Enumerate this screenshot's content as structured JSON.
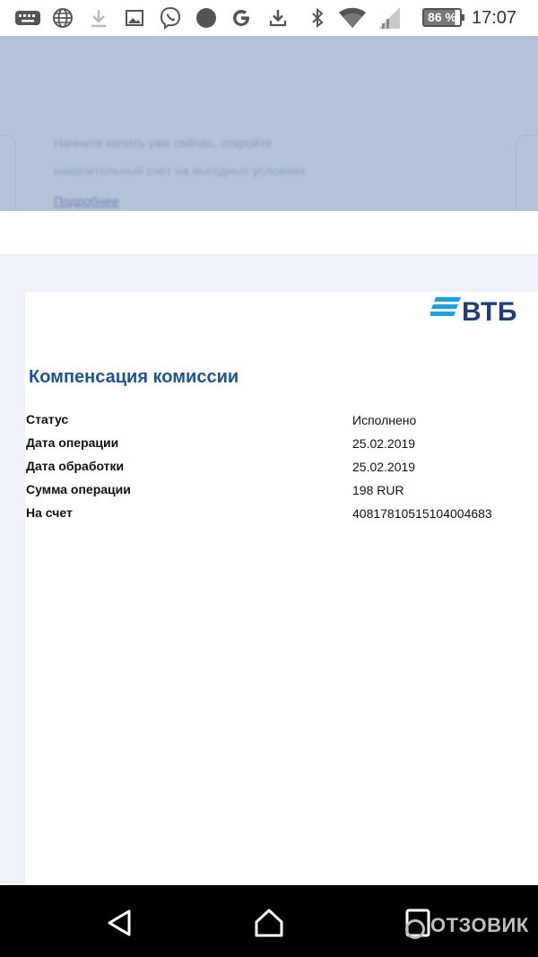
{
  "status_bar": {
    "time": "17:07",
    "battery_percent": "86 %",
    "icons": [
      "keyboard-icon",
      "globe-icon",
      "download-icon",
      "image-icon",
      "viber-icon",
      "circle-icon",
      "google-icon",
      "download-tray-icon",
      "bluetooth-icon",
      "wifi-icon",
      "signal-icon",
      "battery-icon"
    ]
  },
  "banner": {
    "text": "Начните копить уже сейчас, откройте накопительный счет на выгодных условиях",
    "link": "Подробнее"
  },
  "document": {
    "logo_text": "ВТБ",
    "title": "Компенсация комиссии",
    "rows": [
      {
        "label": "Статус",
        "value": "Исполнено"
      },
      {
        "label": "Дата операции",
        "value": "25.02.2019"
      },
      {
        "label": "Дата обработки",
        "value": "25.02.2019"
      },
      {
        "label": "Сумма операции",
        "value": "198 RUR"
      },
      {
        "label": "На счет",
        "value": "40817810515104004683"
      }
    ]
  },
  "nav_bar": {
    "buttons": [
      "back-icon",
      "home-icon",
      "recents-icon"
    ],
    "watermark": "ОТЗОВИК"
  },
  "colors": {
    "title_blue": "#1b5597",
    "logo_blue": "#1f3d7a",
    "logo_stripes": "#1da1e0",
    "banner_bg": "#b4c2d8"
  }
}
